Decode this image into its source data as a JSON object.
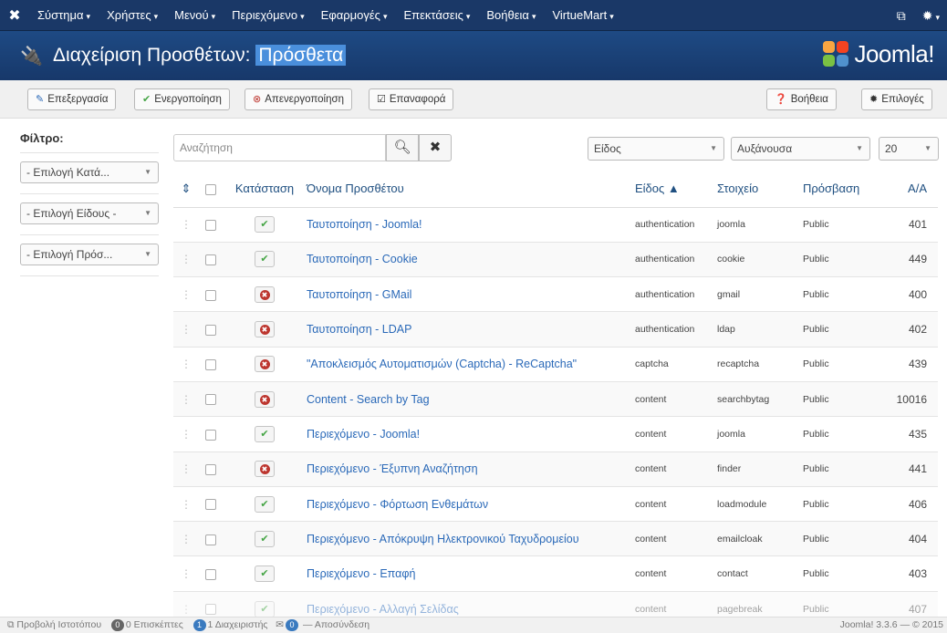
{
  "topnav": {
    "items": [
      "Σύστημα",
      "Χρήστες",
      "Μενού",
      "Περιεχόμενο",
      "Εφαρμογές",
      "Επεκτάσεις",
      "Βοήθεια",
      "VirtueMart"
    ]
  },
  "header": {
    "title_prefix": "Διαχείριση Προσθέτων: ",
    "title_highlight": "Πρόσθετα",
    "logo_text": "Joomla!"
  },
  "toolbar": {
    "edit": "Επεξεργασία",
    "enable": "Ενεργοποίηση",
    "disable": "Απενεργοποίηση",
    "checkin": "Επαναφορά",
    "help": "Βοήθεια",
    "options": "Επιλογές"
  },
  "sidebar": {
    "filter_label": "Φίλτρο:",
    "category_select": "- Επιλογή Κατά...",
    "type_select": "- Επιλογή Είδους -",
    "access_select": "- Επιλογή Πρόσ..."
  },
  "filters": {
    "search_placeholder": "Αναζήτηση",
    "sort_by": "Είδος",
    "sort_dir": "Αυξάνουσα",
    "limit": "20"
  },
  "table": {
    "headers": {
      "status": "Κατάσταση",
      "name": "Όνομα Προσθέτου",
      "type": "Είδος ▲",
      "element": "Στοιχείο",
      "access": "Πρόσβαση",
      "id": "Α/Α"
    },
    "rows": [
      {
        "enabled": true,
        "name": "Ταυτοποίηση - Joomla!",
        "type": "authentication",
        "element": "joomla",
        "access": "Public",
        "id": "401"
      },
      {
        "enabled": true,
        "name": "Ταυτοποίηση - Cookie",
        "type": "authentication",
        "element": "cookie",
        "access": "Public",
        "id": "449"
      },
      {
        "enabled": false,
        "name": "Ταυτοποίηση - GMail",
        "type": "authentication",
        "element": "gmail",
        "access": "Public",
        "id": "400"
      },
      {
        "enabled": false,
        "name": "Ταυτοποίηση - LDAP",
        "type": "authentication",
        "element": "ldap",
        "access": "Public",
        "id": "402"
      },
      {
        "enabled": false,
        "name": "\"Αποκλεισμός Αυτοματισμών (Captcha) - ReCaptcha\"",
        "type": "captcha",
        "element": "recaptcha",
        "access": "Public",
        "id": "439"
      },
      {
        "enabled": false,
        "name": "Content - Search by Tag",
        "type": "content",
        "element": "searchbytag",
        "access": "Public",
        "id": "10016"
      },
      {
        "enabled": true,
        "name": "Περιεχόμενο - Joomla!",
        "type": "content",
        "element": "joomla",
        "access": "Public",
        "id": "435"
      },
      {
        "enabled": false,
        "name": "Περιεχόμενο - Έξυπνη Αναζήτηση",
        "type": "content",
        "element": "finder",
        "access": "Public",
        "id": "441"
      },
      {
        "enabled": true,
        "name": "Περιεχόμενο - Φόρτωση Ενθεμάτων",
        "type": "content",
        "element": "loadmodule",
        "access": "Public",
        "id": "406"
      },
      {
        "enabled": true,
        "name": "Περιεχόμενο - Απόκρυψη Ηλεκτρονικού Ταχυδρομείου",
        "type": "content",
        "element": "emailcloak",
        "access": "Public",
        "id": "404"
      },
      {
        "enabled": true,
        "name": "Περιεχόμενο - Επαφή",
        "type": "content",
        "element": "contact",
        "access": "Public",
        "id": "403"
      },
      {
        "enabled": true,
        "name": "Περιεχόμενο - Αλλαγή Σελίδας",
        "type": "content",
        "element": "pagebreak",
        "access": "Public",
        "id": "407"
      }
    ]
  },
  "footer": {
    "view_site": "Προβολή Ιστοτόπου",
    "visitors_count": "0",
    "visitors_label": "0 Επισκέπτες",
    "admins_count": "1",
    "admins_label": "1 Διαχειριστής",
    "messages_count": "0",
    "logout": "— Αποσύνδεση",
    "version": "Joomla! 3.3.6 — © 2015"
  },
  "colors": {
    "nav_bg": "#1a3867",
    "header_bg": "#1e4a84",
    "link": "#2a69b8",
    "enabled": "#46a546",
    "disabled": "#bd362f"
  }
}
